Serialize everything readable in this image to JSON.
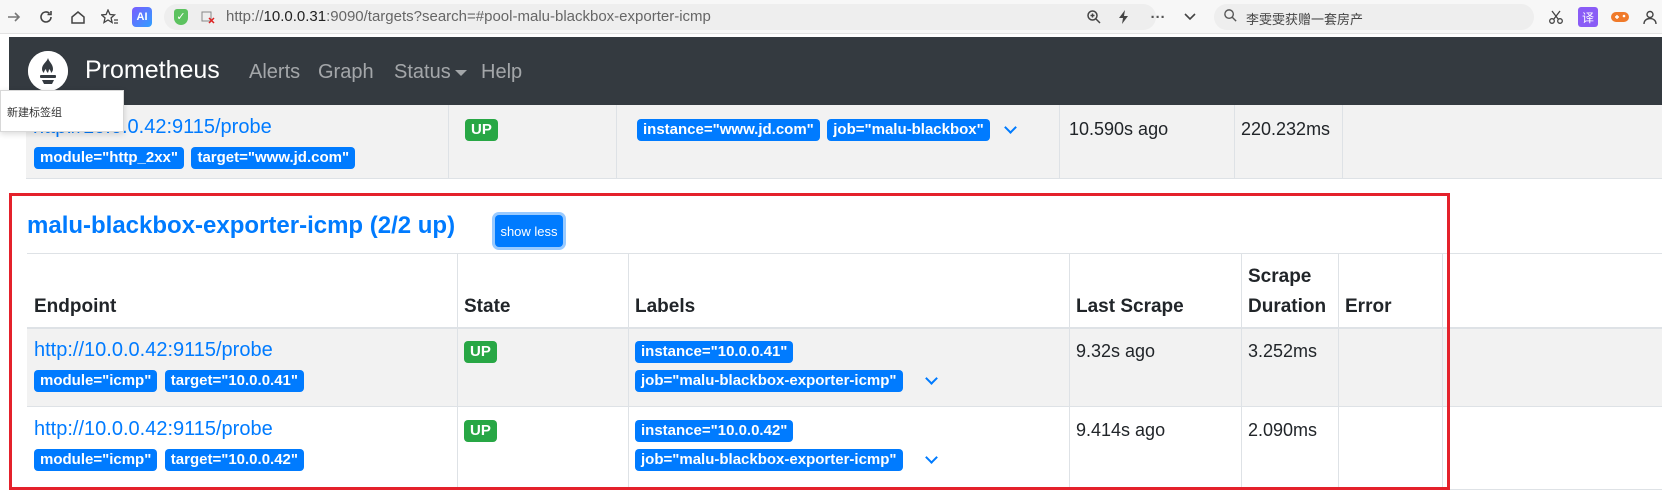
{
  "browser": {
    "url_prefix": "http://",
    "url_host": "10.0.0.31",
    "url_rest": ":9090/targets?search=#pool-malu-blackbox-exporter-icmp",
    "search_text": "李雯雯获赠一套房产",
    "ai_label": "AI",
    "ext_label": "译"
  },
  "tab_popup": "新建标签组",
  "navbar": {
    "brand": "Prometheus",
    "links": [
      "Alerts",
      "Graph",
      "Status",
      "Help"
    ]
  },
  "prev_row": {
    "endpoint": "http://10.0.0.42:9115/probe",
    "params": [
      "module=\"http_2xx\"",
      "target=\"www.jd.com\""
    ],
    "state": "UP",
    "labels": [
      "instance=\"www.jd.com\"",
      "job=\"malu-blackbox\""
    ],
    "last_scrape": "10.590s ago",
    "duration": "220.232ms"
  },
  "pool": {
    "title": "malu-blackbox-exporter-icmp (2/2 up)",
    "toggle_label": "show less",
    "headers": {
      "endpoint": "Endpoint",
      "state": "State",
      "labels": "Labels",
      "last_scrape": "Last Scrape",
      "duration_line1": "Scrape",
      "duration_line2": "Duration",
      "error": "Error"
    },
    "rows": [
      {
        "endpoint": "http://10.0.0.42:9115/probe",
        "params": [
          "module=\"icmp\"",
          "target=\"10.0.0.41\""
        ],
        "state": "UP",
        "labels": [
          "instance=\"10.0.0.41\"",
          "job=\"malu-blackbox-exporter-icmp\""
        ],
        "last_scrape": "9.32s ago",
        "duration": "3.252ms",
        "error": ""
      },
      {
        "endpoint": "http://10.0.0.42:9115/probe",
        "params": [
          "module=\"icmp\"",
          "target=\"10.0.0.42\""
        ],
        "state": "UP",
        "labels": [
          "instance=\"10.0.0.42\"",
          "job=\"malu-blackbox-exporter-icmp\""
        ],
        "last_scrape": "9.414s ago",
        "duration": "2.090ms",
        "error": ""
      }
    ]
  },
  "colors": {
    "accent": "#007bff",
    "up": "#28a745",
    "navbar": "#343a40",
    "highlight": "#e4212b"
  }
}
